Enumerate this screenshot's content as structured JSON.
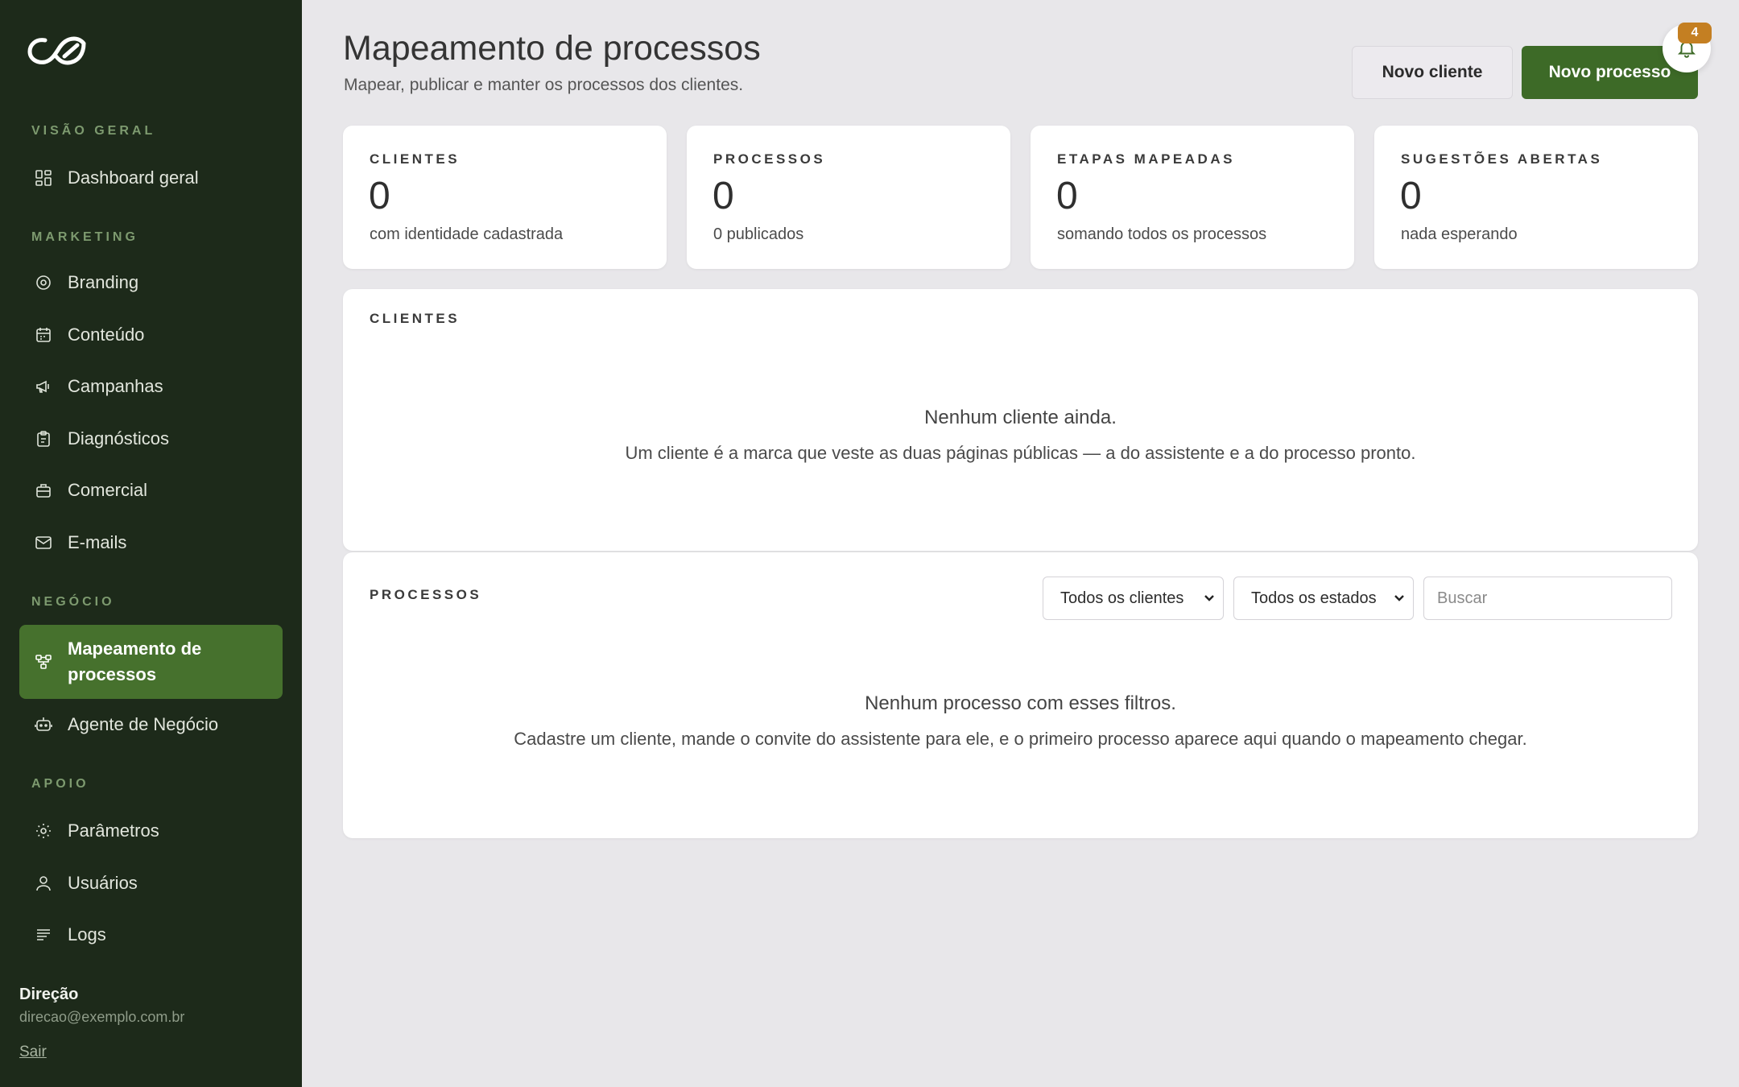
{
  "sidebar": {
    "logo": "leaf-infinity-logo",
    "sections": [
      {
        "title": "VISÃO GERAL",
        "items": [
          {
            "label": "Dashboard geral",
            "icon": "dashboard-grid-icon"
          }
        ]
      },
      {
        "title": "MARKETING",
        "items": [
          {
            "label": "Branding",
            "icon": "target-icon"
          },
          {
            "label": "Conteúdo",
            "icon": "calendar-icon"
          },
          {
            "label": "Campanhas",
            "icon": "megaphone-icon"
          },
          {
            "label": "Diagnósticos",
            "icon": "clipboard-icon"
          },
          {
            "label": "Comercial",
            "icon": "briefcase-icon"
          },
          {
            "label": "E-mails",
            "icon": "mail-icon"
          }
        ]
      },
      {
        "title": "NEGÓCIO",
        "items": [
          {
            "label": "Mapeamento de processos",
            "icon": "workflow-icon",
            "active": true
          },
          {
            "label": "Agente de Negócio",
            "icon": "bot-icon"
          }
        ]
      },
      {
        "title": "APOIO",
        "items": [
          {
            "label": "Parâmetros",
            "icon": "sun-icon"
          },
          {
            "label": "Usuários",
            "icon": "user-icon"
          },
          {
            "label": "Logs",
            "icon": "list-icon"
          }
        ]
      }
    ],
    "user": {
      "name": "Direção",
      "email": "direcao@exemplo.com.br",
      "logout": "Sair"
    }
  },
  "header": {
    "title": "Mapeamento de processos",
    "subtitle": "Mapear, publicar e manter os processos dos clientes.",
    "btn_new_client": "Novo cliente",
    "btn_new_process": "Novo processo",
    "notification_count": "4"
  },
  "stats": [
    {
      "label": "CLIENTES",
      "value": "0",
      "sub": "com identidade cadastrada"
    },
    {
      "label": "PROCESSOS",
      "value": "0",
      "sub": "0 publicados"
    },
    {
      "label": "ETAPAS MAPEADAS",
      "value": "0",
      "sub": "somando todos os processos"
    },
    {
      "label": "SUGESTÕES ABERTAS",
      "value": "0",
      "sub": "nada esperando"
    }
  ],
  "clients_panel": {
    "title": "CLIENTES",
    "empty_title": "Nenhum cliente ainda.",
    "empty_text": "Um cliente é a marca que veste as duas páginas públicas — a do assistente e a do processo pronto."
  },
  "processes_panel": {
    "title": "PROCESSOS",
    "filter_client": "Todos os clientes",
    "filter_state": "Todos os estados",
    "search_placeholder": "Buscar",
    "empty_title": "Nenhum processo com esses filtros.",
    "empty_text": "Cadastre um cliente, mande o convite do assistente para ele, e o primeiro processo aparece aqui quando o mapeamento chegar."
  },
  "colors": {
    "sidebar_bg": "#1d2a1a",
    "accent": "#3d6a27",
    "active_bg": "#46712d",
    "badge": "#c47f22"
  }
}
